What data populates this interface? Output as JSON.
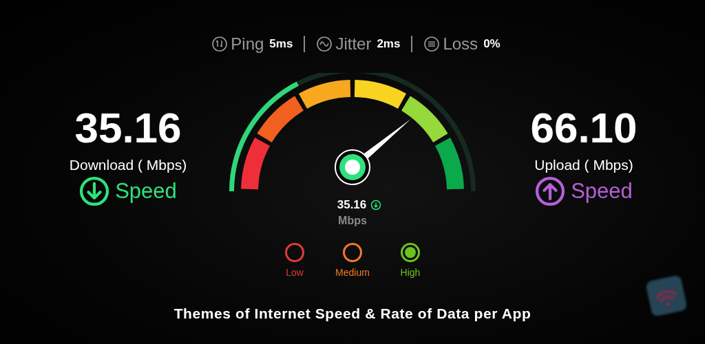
{
  "stats": [
    {
      "kind": "ping",
      "label": "Ping",
      "value": "5ms"
    },
    {
      "kind": "jitter",
      "label": "Jitter",
      "value": "2ms"
    },
    {
      "kind": "loss",
      "label": "Loss",
      "value": "0%"
    }
  ],
  "download": {
    "value": "35.16",
    "label": "Download ( Mbps)",
    "speed": "Speed"
  },
  "upload": {
    "value": "66.10",
    "label": "Upload ( Mbps)",
    "speed": "Speed"
  },
  "gauge": {
    "reading": "35.16",
    "unit": "Mbps"
  },
  "legend": [
    {
      "label": "Low",
      "color": "#e03a3a",
      "selected": false
    },
    {
      "label": "Medium",
      "color": "#f07a2a",
      "selected": false
    },
    {
      "label": "High",
      "color": "#6cc21e",
      "selected": true
    }
  ],
  "caption": "Themes of Internet Speed & Rate of Data per App"
}
